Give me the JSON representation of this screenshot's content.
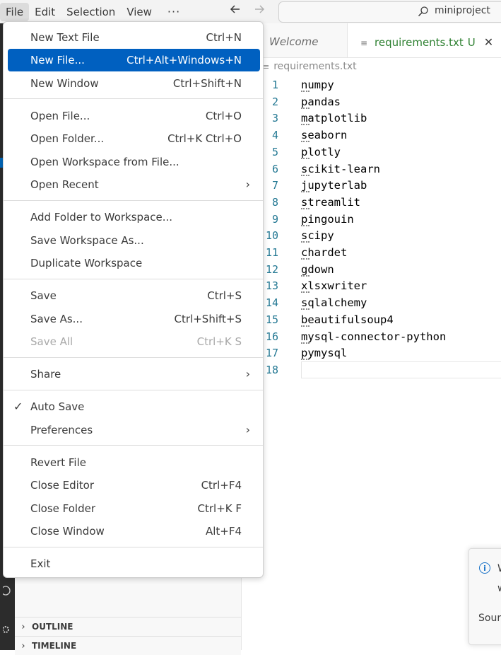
{
  "menubar": {
    "file": "File",
    "edit": "Edit",
    "selection": "Selection",
    "view": "View",
    "more": "···"
  },
  "nav": {
    "back_icon": "arrow-left-icon",
    "forward_icon": "arrow-right-icon"
  },
  "search": {
    "text": "miniproject",
    "icon": "search-icon"
  },
  "tabs": {
    "welcome": "Welcome",
    "active": "requirements.txt",
    "active_status": "U",
    "close_glyph": "✕"
  },
  "breadcrumb": "requirements.txt",
  "editor": {
    "lines": [
      {
        "n": "1",
        "text": "numpy"
      },
      {
        "n": "2",
        "text": "pandas"
      },
      {
        "n": "3",
        "text": "matplotlib"
      },
      {
        "n": "4",
        "text": "seaborn"
      },
      {
        "n": "5",
        "text": "plotly"
      },
      {
        "n": "6",
        "text": "scikit-learn"
      },
      {
        "n": "7",
        "text": "jupyterlab"
      },
      {
        "n": "8",
        "text": "streamlit"
      },
      {
        "n": "9",
        "text": "pingouin"
      },
      {
        "n": "10",
        "text": "scipy"
      },
      {
        "n": "11",
        "text": "chardet"
      },
      {
        "n": "12",
        "text": "gdown"
      },
      {
        "n": "13",
        "text": "xlsxwriter"
      },
      {
        "n": "14",
        "text": "sqlalchemy"
      },
      {
        "n": "15",
        "text": "beautifulsoup4"
      },
      {
        "n": "16",
        "text": "mysql-connector-python"
      },
      {
        "n": "17",
        "text": "pymysql"
      },
      {
        "n": "18",
        "text": ""
      }
    ]
  },
  "file_menu": {
    "new_text_file": {
      "label": "New Text File",
      "key": "Ctrl+N"
    },
    "new_file": {
      "label": "New File...",
      "key": "Ctrl+Alt+Windows+N"
    },
    "new_window": {
      "label": "New Window",
      "key": "Ctrl+Shift+N"
    },
    "open_file": {
      "label": "Open File...",
      "key": "Ctrl+O"
    },
    "open_folder": {
      "label": "Open Folder...",
      "key": "Ctrl+K Ctrl+O"
    },
    "open_workspace": {
      "label": "Open Workspace from File..."
    },
    "open_recent": {
      "label": "Open Recent"
    },
    "add_folder": {
      "label": "Add Folder to Workspace..."
    },
    "save_workspace_as": {
      "label": "Save Workspace As..."
    },
    "duplicate_workspace": {
      "label": "Duplicate Workspace"
    },
    "save": {
      "label": "Save",
      "key": "Ctrl+S"
    },
    "save_as": {
      "label": "Save As...",
      "key": "Ctrl+Shift+S"
    },
    "save_all": {
      "label": "Save All",
      "key": "Ctrl+K S"
    },
    "share": {
      "label": "Share"
    },
    "auto_save": {
      "label": "Auto Save",
      "checked": true
    },
    "preferences": {
      "label": "Preferences"
    },
    "revert_file": {
      "label": "Revert File"
    },
    "close_editor": {
      "label": "Close Editor",
      "key": "Ctrl+F4"
    },
    "close_folder": {
      "label": "Close Folder",
      "key": "Ctrl+K F"
    },
    "close_window": {
      "label": "Close Window",
      "key": "Alt+F4"
    },
    "exit": {
      "label": "Exit"
    }
  },
  "panels": {
    "outline": "OUTLINE",
    "timeline": "TIMELINE"
  },
  "toast": {
    "line1": "W",
    "line2": "w",
    "source": "Sourc",
    "icon": "info-icon"
  },
  "colors": {
    "accent": "#0060c0",
    "modified": "#2f8132",
    "line_number": "#237893"
  }
}
